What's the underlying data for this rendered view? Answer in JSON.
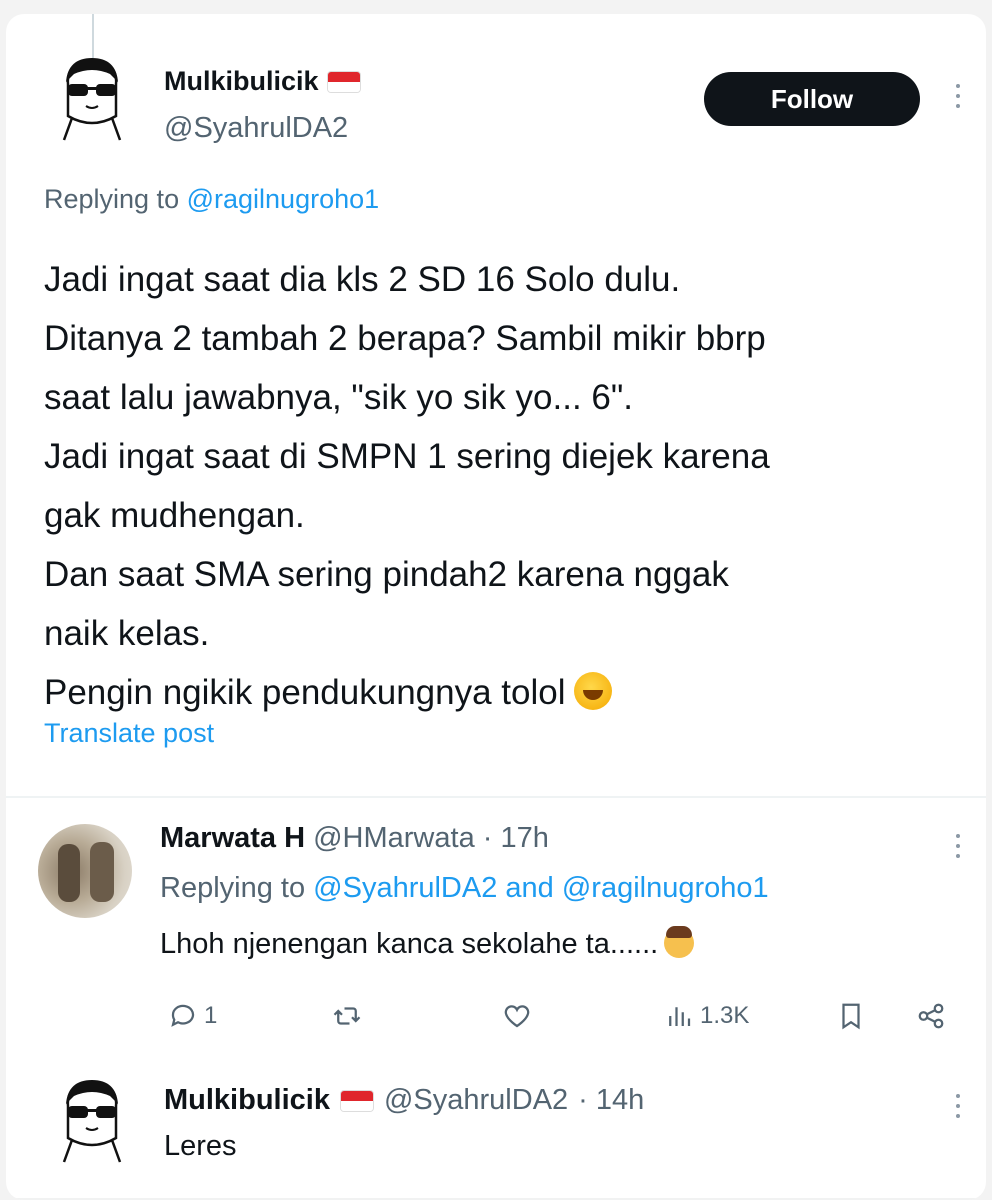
{
  "main_post": {
    "name": "Mulkibulicik",
    "handle": "@SyahrulDA2",
    "follow_label": "Follow",
    "replying_prefix": "Replying to",
    "replying_to": "@ragilnugroho1",
    "body_lines": [
      "Jadi ingat saat dia kls 2 SD 16 Solo dulu.",
      "Ditanya 2 tambah 2 berapa? Sambil mikir bbrp",
      "saat lalu jawabnya, \"sik yo sik yo... 6\".",
      "Jadi ingat saat di SMPN 1 sering diejek karena",
      "gak mudhengan.",
      "Dan saat SMA sering pindah2 karena nggak",
      "naik kelas.",
      "Pengin ngikik pendukungnya tolol"
    ],
    "translate_label": "Translate post"
  },
  "reply1": {
    "name": "Marwata H",
    "handle": "@HMarwata",
    "time": "· 17h",
    "replying_prefix": "Replying to",
    "replying_to_1": "@SyahrulDA2",
    "replying_and": "and",
    "replying_to_2": "@ragilnugroho1",
    "body": "Lhoh njenengan kanca sekolahe ta......",
    "stats": {
      "replies": "1",
      "retweets": "",
      "likes": "",
      "views": "1.3K"
    }
  },
  "reply2": {
    "name": "Mulkibulicik",
    "handle": "@SyahrulDA2",
    "time": "· 14h",
    "body": "Leres"
  },
  "icons": [
    "more-icon",
    "reply-icon",
    "retweet-icon",
    "like-icon",
    "views-icon",
    "bookmark-icon",
    "share-icon",
    "flag-icon",
    "laughing-emoji",
    "facepalm-emoji"
  ],
  "colors": {
    "accent": "#1d9bf0",
    "text": "#0f1419",
    "secondary": "#536471",
    "follow_bg": "#0f1419"
  }
}
